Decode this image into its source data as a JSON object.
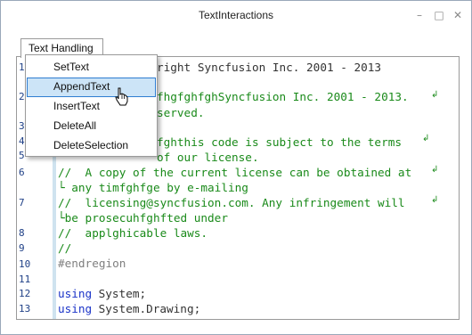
{
  "window": {
    "title": "TextInteractions"
  },
  "title_controls": {
    "minimize": "–",
    "maximize": "□",
    "close": "✕"
  },
  "menu": {
    "title": "Text Handling",
    "items": [
      {
        "label": "SetText"
      },
      {
        "label": "AppendText"
      },
      {
        "label": "InsertText"
      },
      {
        "label": "DeleteAll"
      },
      {
        "label": "DeleteSelection"
      }
    ],
    "highlighted_item": "AppendText"
  },
  "editor": {
    "line_numbers": [
      "1",
      "2",
      "3",
      "4",
      "5",
      "6",
      "7",
      "8",
      "9",
      "10",
      "11",
      "12",
      "13"
    ],
    "lines": [
      "right Syncfusion Inc. 2001 - 2013",
      "fhgfghfghSyncfusion Inc. 2001 - 2013.",
      "served.",
      "fghthis code is subject to the terms",
      "of our license.",
      "//  A copy of the current license can be obtained at",
      "└ any timfghfge by e-mailing",
      "//  licensing@syncfusion.com. Any infringement will",
      "└be prosecuhfghfted under",
      "//  applghicable laws.",
      "//",
      "#endregion",
      "using",
      " System;",
      "using",
      " System.Drawing;"
    ],
    "wrap_marker": "↲",
    "colors": {
      "comment": "#1a8a1a",
      "keyword": "#1b34c8",
      "region": "#7f7f7f",
      "line_number": "#1e3f86"
    }
  }
}
